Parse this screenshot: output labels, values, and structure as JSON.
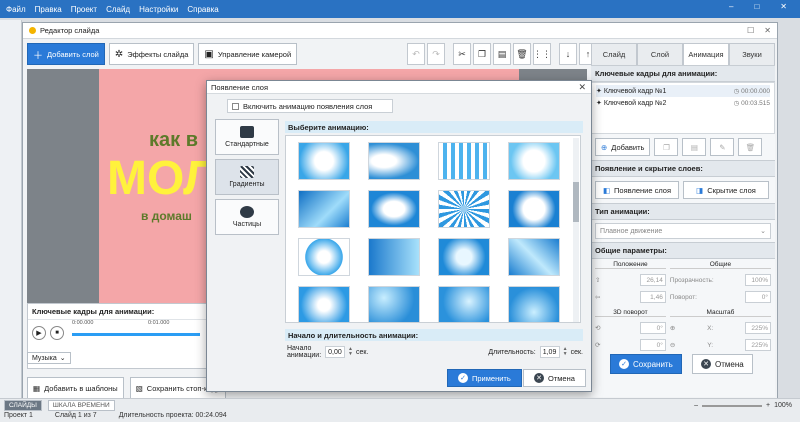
{
  "menu": [
    "Файл",
    "Правка",
    "Проект",
    "Слайд",
    "Настройки",
    "Справка"
  ],
  "editor": {
    "title": "Редактор слайда",
    "toolbar": {
      "add_layer": "Добавить слой",
      "slide_effects": "Эффекты слайда",
      "camera": "Управление камерой"
    },
    "slide_text": {
      "line1": "как в",
      "line2": "МОЛ",
      "line3": "в домаш"
    },
    "keyframes_title": "Ключевые кадры для анимации:",
    "timeline": {
      "t0": "0:00.000",
      "t1": "0:01.000"
    },
    "music_label": "Музыка",
    "add_template": "Добавить в шаблоны",
    "save_stopframe": "Сохранить стоп-кадр",
    "save": "Сохранить",
    "cancel": "Отмена"
  },
  "right_panel": {
    "tabs": [
      "Слайд",
      "Слой",
      "Анимация",
      "Звуки"
    ],
    "active_tab": "Анимация",
    "keyframes_header": "Ключевые кадры для анимации:",
    "keyframes": [
      {
        "name": "Ключевой кадр №1",
        "time": "00:00.000"
      },
      {
        "name": "Ключевой кадр №2",
        "time": "00:03.515"
      }
    ],
    "add_btn": "Добавить",
    "appear_header": "Появление и скрытие слоев:",
    "appear_btn": "Появление слоя",
    "hide_btn": "Скрытие слоя",
    "anim_type_header": "Тип анимации:",
    "anim_type_value": "Плавное движение",
    "params_header": "Общие параметры:",
    "position_label": "Положение",
    "general_label": "Общие",
    "pos_x": "26,14",
    "pos_y": "1,46",
    "opacity_label": "Прозрачность:",
    "opacity_value": "100%",
    "rotation_label": "Поворот:",
    "rotation_value": "0°",
    "rot3d_label": "3D поворот",
    "scale_label": "Масштаб",
    "rot3d_a": "0°",
    "rot3d_b": "0°",
    "scale_x_label": "X:",
    "scale_x": "225%",
    "scale_y_label": "Y:",
    "scale_y": "225%"
  },
  "dialog": {
    "title": "Появление слоя",
    "enable_label": "Включить анимацию появления слоя",
    "categories": [
      "Стандартные",
      "Градиенты",
      "Частицы"
    ],
    "active_category": "Градиенты",
    "pick_title": "Выберите анимацию:",
    "duration_title": "Начало и длительность анимации:",
    "start_label": "Начало анимации:",
    "start_value": "0,00",
    "duration_label": "Длительность:",
    "duration_value": "1,09",
    "unit": "сек.",
    "apply": "Применить",
    "cancel": "Отмена"
  },
  "status": {
    "tab_slides": "СЛАЙДЫ",
    "tab_timeline": "ШКАЛА ВРЕМЕНИ",
    "project": "Проект 1",
    "slide_info": "Слайд 1 из 7",
    "duration": "Длительность проекта: 00:24.094",
    "zoom": "100%"
  },
  "colors": {
    "accent": "#2a7ad8",
    "menubar": "#2a72c2",
    "slide_bg": "#f4a6a8",
    "title_yellow": "#fff23c",
    "text_green": "#5d7a2a"
  }
}
